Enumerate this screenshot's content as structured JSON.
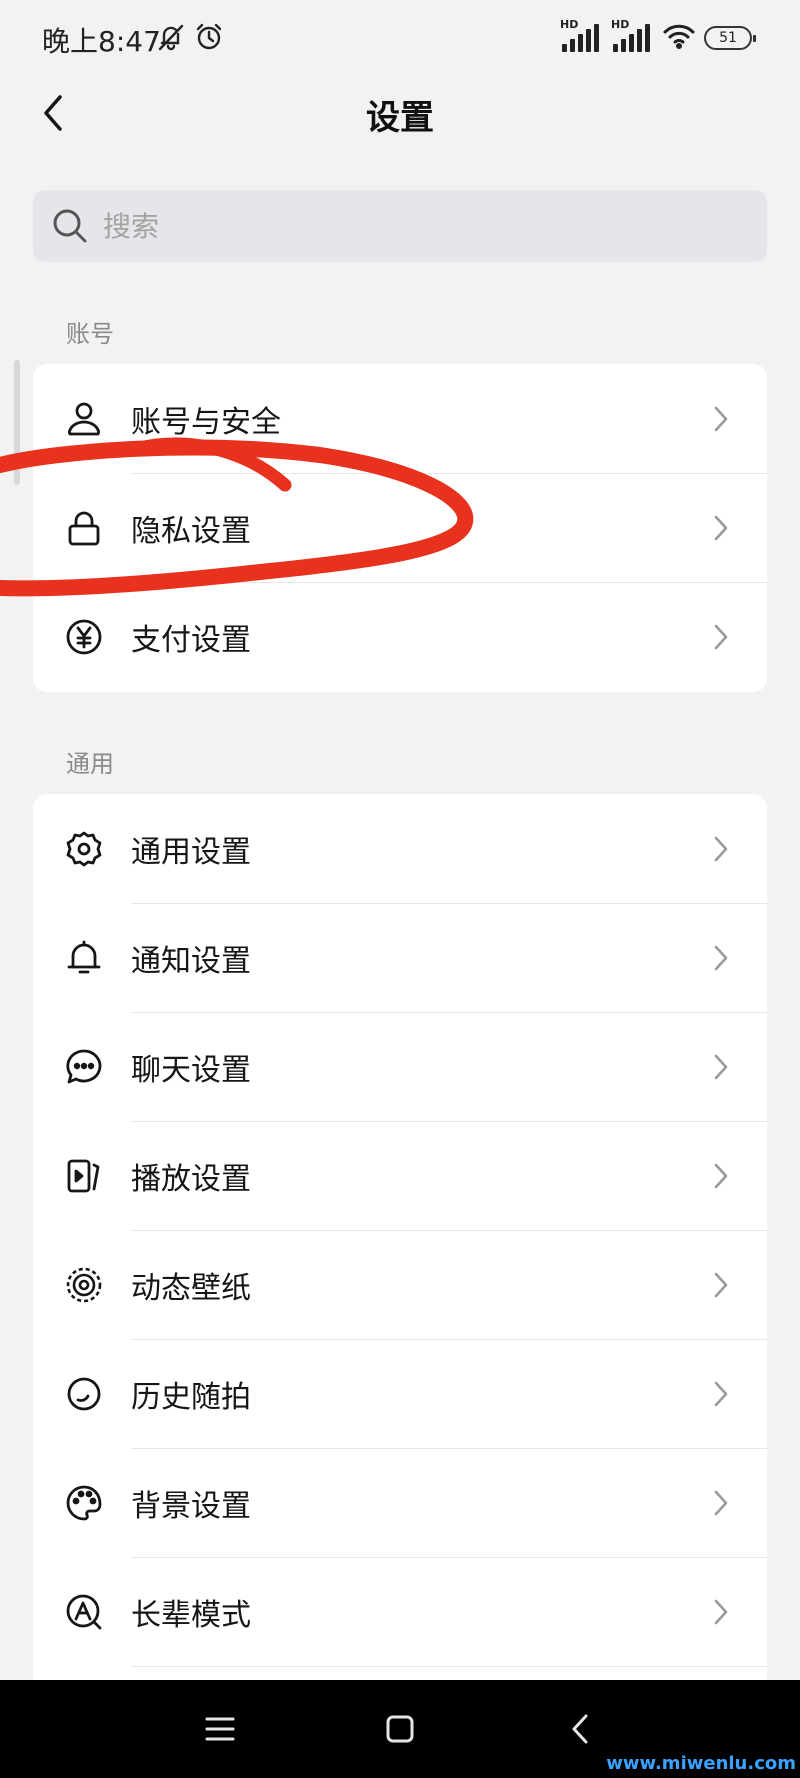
{
  "status_bar": {
    "time": "晚上8:47",
    "left_icons": [
      "bell-off-icon",
      "alarm-icon"
    ],
    "network_label_1": "HD",
    "network_label_2": "HD",
    "battery": "51"
  },
  "header": {
    "title": "设置",
    "back_icon": "chevron-left-icon"
  },
  "search": {
    "placeholder": "搜索",
    "icon": "search-icon"
  },
  "sections": {
    "account": {
      "label": "账号",
      "items": [
        {
          "label": "账号与安全",
          "icon": "person-icon"
        },
        {
          "label": "隐私设置",
          "icon": "lock-icon"
        },
        {
          "label": "支付设置",
          "icon": "yen-icon"
        }
      ]
    },
    "general": {
      "label": "通用",
      "items": [
        {
          "label": "通用设置",
          "icon": "gear-icon"
        },
        {
          "label": "通知设置",
          "icon": "bell-icon"
        },
        {
          "label": "聊天设置",
          "icon": "chat-bubble-icon"
        },
        {
          "label": "播放设置",
          "icon": "play-card-icon"
        },
        {
          "label": "动态壁纸",
          "icon": "live-wallpaper-icon"
        },
        {
          "label": "历史随拍",
          "icon": "circle-history-icon"
        },
        {
          "label": "背景设置",
          "icon": "palette-icon"
        },
        {
          "label": "长辈模式",
          "icon": "elder-mode-icon"
        }
      ]
    }
  },
  "annotation_color": "#e8321e",
  "nav_bar": {
    "buttons": [
      "menu-icon",
      "home-square-icon",
      "back-triangle-icon"
    ]
  },
  "watermark": "www.miwenlu.com"
}
